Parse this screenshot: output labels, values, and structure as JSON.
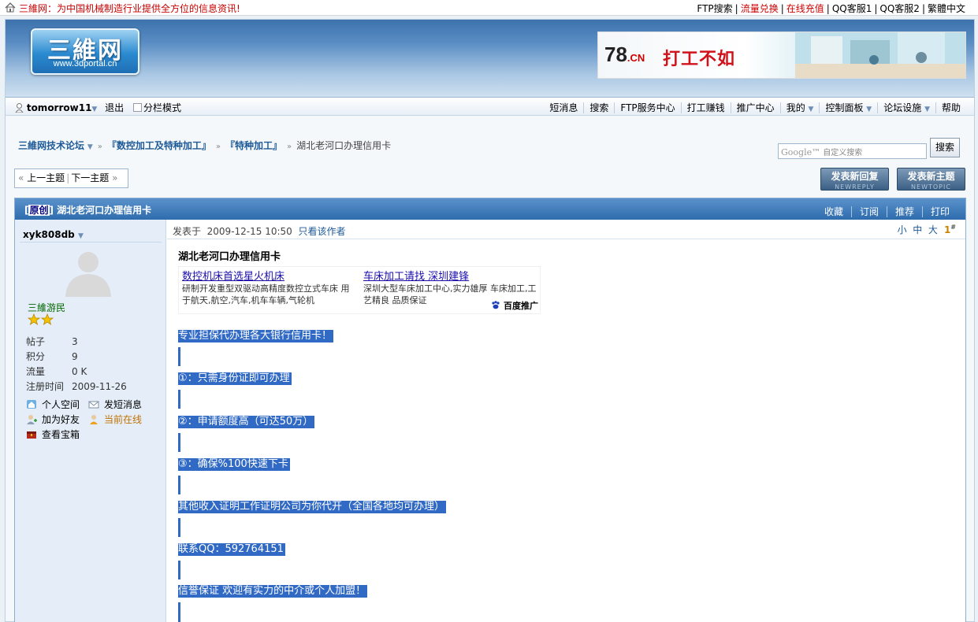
{
  "topbar": {
    "site": "三維网",
    "slogan": "：为中国机械制造行业提供全方位的信息资讯!",
    "links": [
      {
        "label": "FTP搜索",
        "color": "#000000"
      },
      {
        "label": "流量兑换",
        "color": "#cc0000"
      },
      {
        "label": "在线充值",
        "color": "#cc0000"
      },
      {
        "label": "QQ客服1",
        "color": "#000000"
      },
      {
        "label": "QQ客服2",
        "color": "#000000"
      },
      {
        "label": "繁體中文",
        "color": "#000000"
      }
    ]
  },
  "header": {
    "logo_text": "三維网",
    "logo_url": "www.3dportal.cn",
    "banner_brand": "78",
    "banner_brand_suffix": ".CN",
    "banner_slogan": "打工不如"
  },
  "nav": {
    "username": "tomorrow11",
    "logout": "退出",
    "split_mode": "分栏模式",
    "items": [
      "短消息",
      "搜索",
      "FTP服务中心",
      "打工赚钱",
      "推广中心",
      "我的",
      "控制面板",
      "论坛设施",
      "帮助"
    ]
  },
  "breadcrumb": {
    "forum": "三維网技术论坛",
    "cat1": "『数控加工及特种加工』",
    "cat2": "『特种加工』",
    "current": "湖北老河口办理信用卡"
  },
  "search": {
    "placeholder_logo": "Google™",
    "placeholder": "自定义搜索",
    "button": "搜索"
  },
  "pager": {
    "prev": "上一主题",
    "next": "下一主题"
  },
  "buttons": {
    "reply": "发表新回复",
    "reply_en": "NEWREPLY",
    "topic": "发表新主题",
    "topic_en": "NEWTOPIC"
  },
  "post": {
    "tag": "原创",
    "title": "湖北老河口办理信用卡",
    "actions": [
      "收藏",
      "订阅",
      "推荐",
      "打印"
    ],
    "posted_label": "发表于",
    "posted_time": "2009-12-15 10:50",
    "only_author": "只看该作者",
    "font_sizes": [
      "小",
      "中",
      "大"
    ],
    "floor": "1",
    "floor_sup": "#",
    "body_title": "湖北老河口办理信用卡",
    "lines": [
      "专业担保代办理各大银行信用卡！",
      "①：只需身份证即可办理",
      "②：申请额度高（可达50万）",
      "③：确保%100快速下卡",
      "其他收入证明工作证明公司为你代开（全国各地均可办理）",
      "联系QQ：592764151",
      "信誉保证 欢迎有实力的中介或个人加盟！"
    ]
  },
  "ad": {
    "items": [
      {
        "title": "数控机床首选星火机床",
        "desc": "研制开发重型双驱动高精度数控立式车床 用于航天,航空,汽车,机车车辆,气轮机"
      },
      {
        "title": "车床加工请找 深圳建锋",
        "desc": "深圳大型车床加工中心,实力雄厚 车床加工,工艺精良 品质保证"
      }
    ],
    "provider": "百度推广"
  },
  "author": {
    "name": "xyk808db",
    "rank": "三維游民",
    "stats": [
      {
        "k": "帖子",
        "v": "3"
      },
      {
        "k": "积分",
        "v": "9"
      },
      {
        "k": "流量",
        "v": "0 K"
      },
      {
        "k": "注册时间",
        "v": "2009-11-26"
      }
    ],
    "links": {
      "space": "个人空间",
      "pm": "发短消息",
      "friend": "加为好友",
      "online": "当前在线",
      "treasure": "查看宝箱"
    }
  }
}
